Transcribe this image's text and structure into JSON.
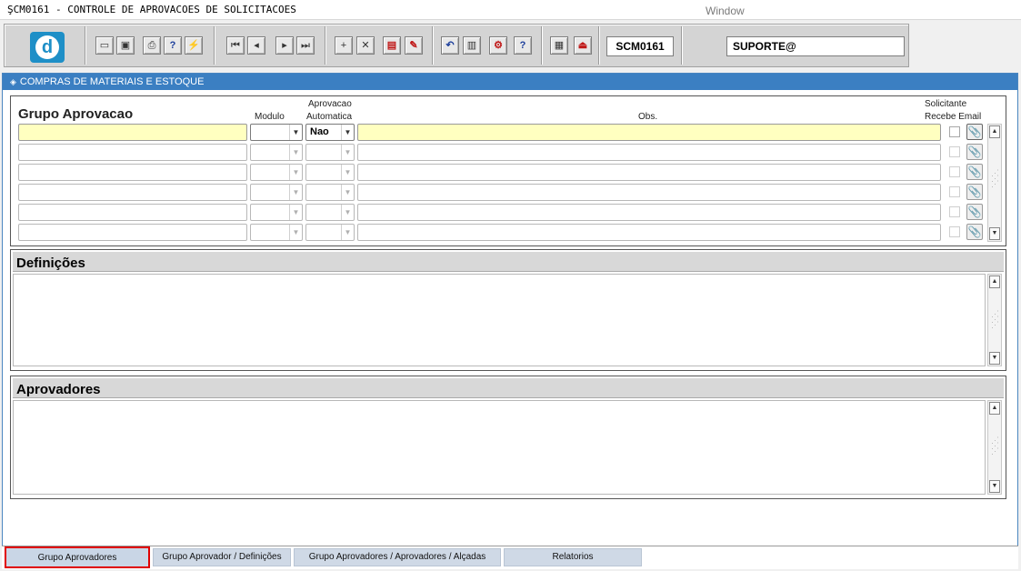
{
  "window": {
    "title": "ŞCM0161 - CONTROLE DE APROVACOES DE SOLICITACOES",
    "menu_window": "Window"
  },
  "toolbar": {
    "logo_letter": "d",
    "screen_code": "SCM0161",
    "user": "SUPORTE@",
    "buttons": [
      {
        "name": "save",
        "glyph": "▭"
      },
      {
        "name": "print-screen",
        "glyph": "▣"
      },
      {
        "name": "print",
        "glyph": "⎙"
      },
      {
        "name": "query-help",
        "glyph": "?"
      },
      {
        "name": "query-run",
        "glyph": "⚡"
      },
      {
        "name": "first-record",
        "glyph": "⏮"
      },
      {
        "name": "previous-record",
        "glyph": "◂"
      },
      {
        "name": "next-record",
        "glyph": "▸"
      },
      {
        "name": "last-record",
        "glyph": "⏭"
      },
      {
        "name": "insert-record",
        "glyph": "+"
      },
      {
        "name": "delete-record",
        "glyph": "✕"
      },
      {
        "name": "lov",
        "glyph": "▤"
      },
      {
        "name": "edit",
        "glyph": "✎"
      },
      {
        "name": "undo",
        "glyph": "↶"
      },
      {
        "name": "clipboard",
        "glyph": "▥"
      },
      {
        "name": "settings",
        "glyph": "⚙"
      },
      {
        "name": "help",
        "glyph": "?"
      },
      {
        "name": "menu",
        "glyph": "▦"
      },
      {
        "name": "exit",
        "glyph": "⏏"
      }
    ]
  },
  "form": {
    "header": "COMPRAS DE MATERIAIS E ESTOQUE",
    "grupo_block": {
      "title": "Grupo Aprovacao",
      "col_modulo": "Modulo",
      "col_aprov_line1": "Aprovacao",
      "col_aprov_line2": "Automatica",
      "col_obs": "Obs.",
      "col_solic_line1": "Solicitante",
      "col_solic_line2": "Recebe Email",
      "rows": [
        {
          "grupo": "",
          "modulo": "",
          "aprovacao": "Nao",
          "obs": "",
          "active": true
        },
        {
          "grupo": "",
          "modulo": "",
          "aprovacao": "",
          "obs": "",
          "active": false
        },
        {
          "grupo": "",
          "modulo": "",
          "aprovacao": "",
          "obs": "",
          "active": false
        },
        {
          "grupo": "",
          "modulo": "",
          "aprovacao": "",
          "obs": "",
          "active": false
        },
        {
          "grupo": "",
          "modulo": "",
          "aprovacao": "",
          "obs": "",
          "active": false
        },
        {
          "grupo": "",
          "modulo": "",
          "aprovacao": "",
          "obs": "",
          "active": false
        }
      ]
    },
    "definicoes_block": {
      "title": "Definições",
      "text": ""
    },
    "aprovadores_block": {
      "title": "Aprovadores",
      "text": ""
    }
  },
  "tabs": [
    {
      "label": "Grupo Aprovadores",
      "active": true
    },
    {
      "label": "Grupo Aprovador / Definições",
      "active": false
    },
    {
      "label": "Grupo Aprovadores / Aprovadores / Alçadas",
      "active": false
    },
    {
      "label": "Relatorios",
      "active": false
    }
  ],
  "colors": {
    "accent": "#3b7fc2",
    "active_field": "#ffffc0",
    "tab_highlight": "#e00000"
  }
}
